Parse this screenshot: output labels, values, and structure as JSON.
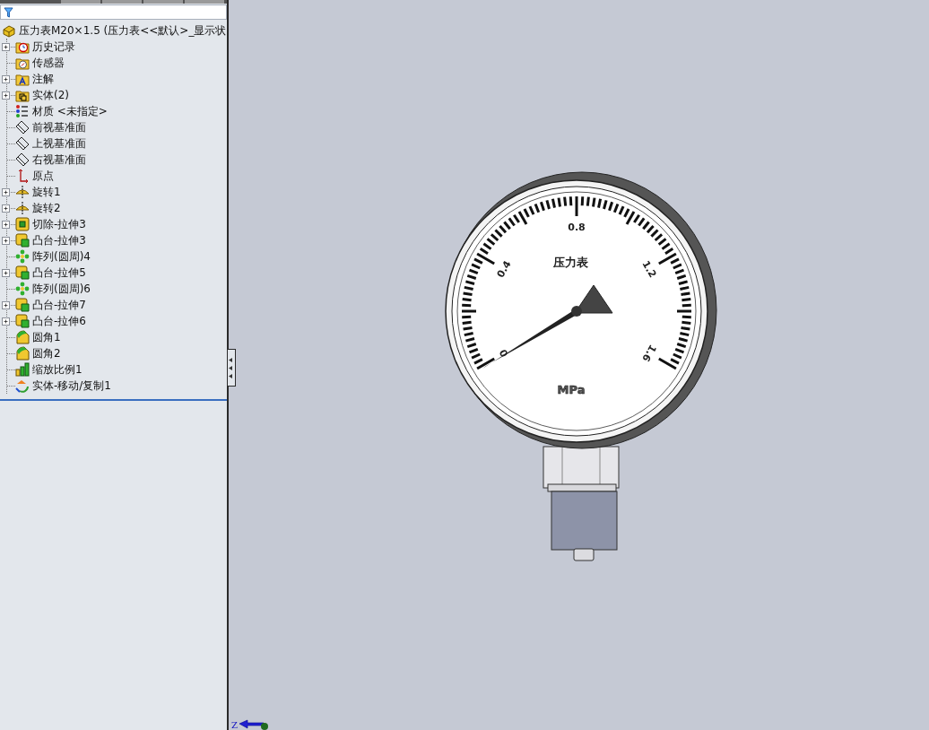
{
  "feature_tree": {
    "root": {
      "label": "压力表M20×1.5  (压力表<<默认>_显示状",
      "kind": "part"
    },
    "items": [
      {
        "label": "历史记录",
        "kind": "history",
        "expandable": true
      },
      {
        "label": "传感器",
        "kind": "sensor",
        "expandable": false
      },
      {
        "label": "注解",
        "kind": "annotation",
        "expandable": true
      },
      {
        "label": "实体(2)",
        "kind": "solids",
        "expandable": true
      },
      {
        "label": "材质 <未指定>",
        "kind": "material",
        "expandable": false
      },
      {
        "label": "前视基准面",
        "kind": "plane",
        "expandable": false
      },
      {
        "label": "上视基准面",
        "kind": "plane",
        "expandable": false
      },
      {
        "label": "右视基准面",
        "kind": "plane",
        "expandable": false
      },
      {
        "label": "原点",
        "kind": "origin",
        "expandable": false
      },
      {
        "label": "旋转1",
        "kind": "revolve",
        "expandable": true
      },
      {
        "label": "旋转2",
        "kind": "revolve",
        "expandable": true
      },
      {
        "label": "切除-拉伸3",
        "kind": "cut",
        "expandable": true
      },
      {
        "label": "凸台-拉伸3",
        "kind": "boss",
        "expandable": true
      },
      {
        "label": "阵列(圆周)4",
        "kind": "pattern",
        "expandable": false
      },
      {
        "label": "凸台-拉伸5",
        "kind": "boss",
        "expandable": true
      },
      {
        "label": "阵列(圆周)6",
        "kind": "pattern",
        "expandable": false
      },
      {
        "label": "凸台-拉伸7",
        "kind": "boss",
        "expandable": true
      },
      {
        "label": "凸台-拉伸6",
        "kind": "boss",
        "expandable": true
      },
      {
        "label": "圆角1",
        "kind": "fillet",
        "expandable": false
      },
      {
        "label": "圆角2",
        "kind": "fillet",
        "expandable": false
      },
      {
        "label": "缩放比例1",
        "kind": "scale",
        "expandable": false
      },
      {
        "label": "实体-移动/复制1",
        "kind": "move",
        "expandable": false
      }
    ]
  },
  "viewport": {
    "model": {
      "dial_labels": [
        "0",
        "0.4",
        "0.8",
        "1.2",
        "1.6"
      ],
      "dial_title": "压力表",
      "unit": "MPa"
    },
    "triad": {
      "axis_label": "Z"
    }
  }
}
